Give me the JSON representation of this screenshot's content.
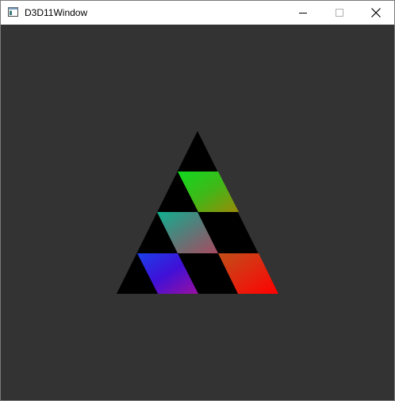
{
  "window": {
    "title": "D3D11Window",
    "background_color": "#333333"
  },
  "caption_buttons": {
    "minimize_icon": "minimize-icon",
    "maximize_icon": "maximize-icon",
    "close_icon": "close-icon"
  },
  "scene": {
    "description_colors": {
      "black": "#000000",
      "green_top": "#1fd11f",
      "olive": "#8a9a10",
      "teal": "#1aa89a",
      "mauve": "#9a5070",
      "blue": "#2418e8",
      "purple": "#8a10a8",
      "orange": "#e05010",
      "red": "#ff0808"
    }
  }
}
